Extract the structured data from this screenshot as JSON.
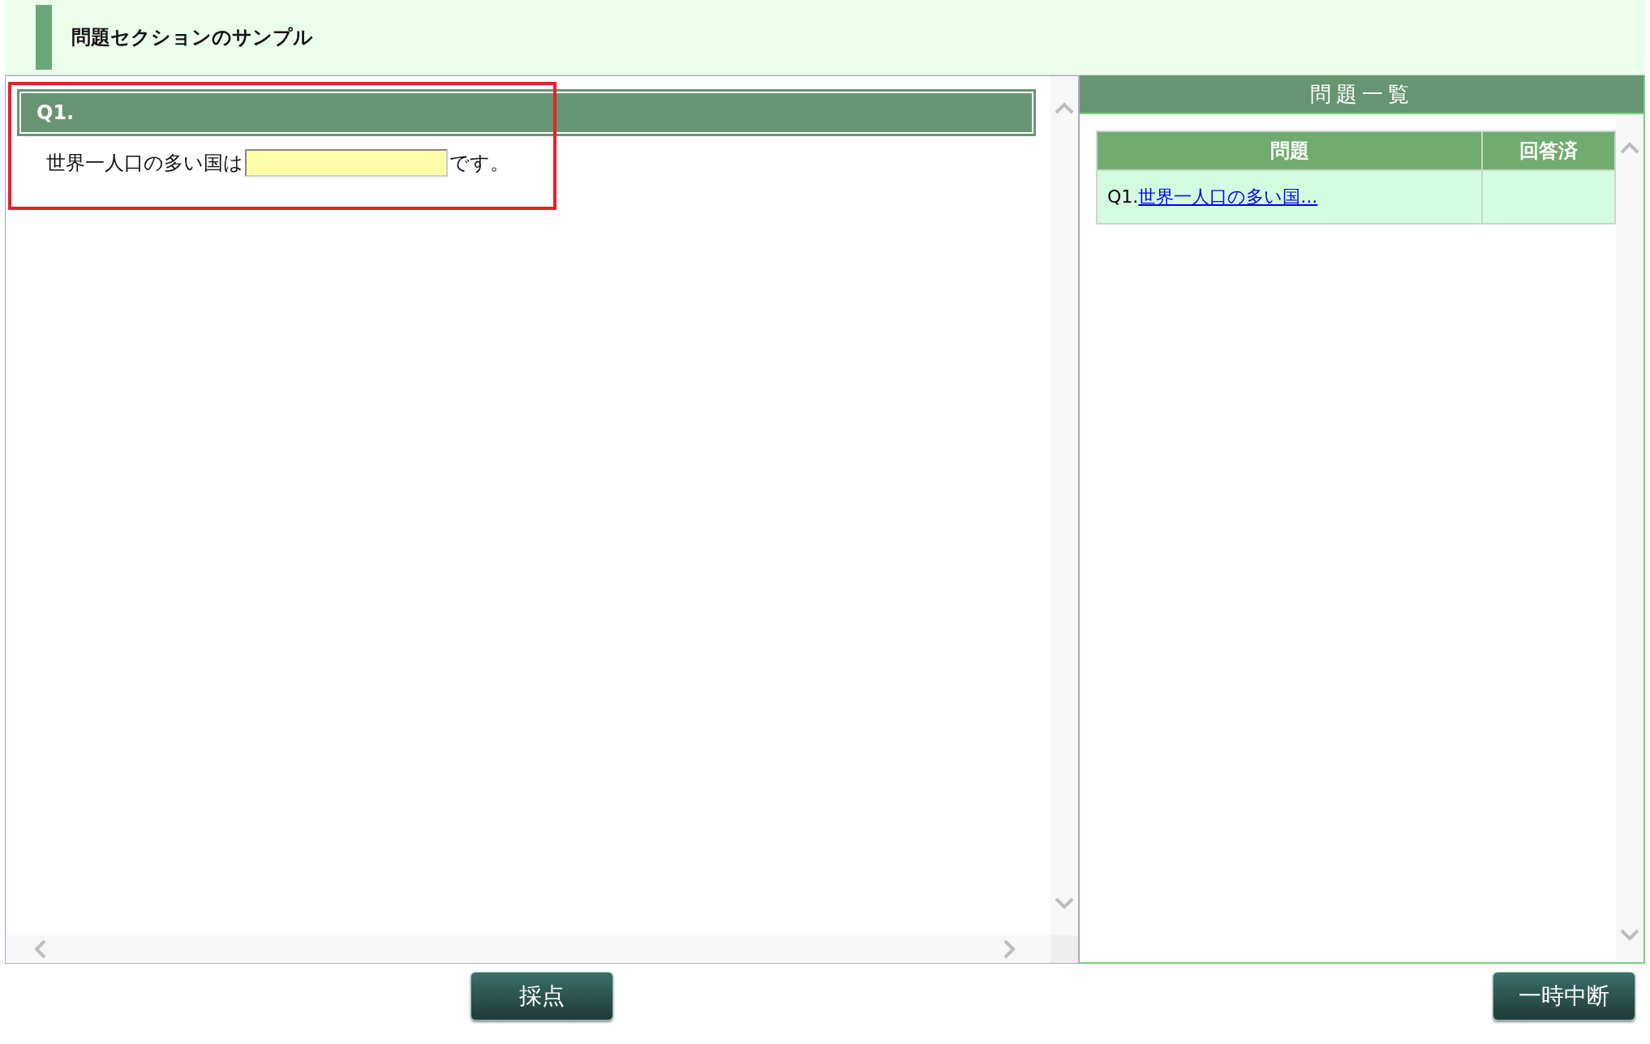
{
  "header": {
    "title": "問題セクションのサンプル"
  },
  "question": {
    "label": "Q1.",
    "before": "世界一人口の多い国は",
    "after": "です。",
    "highlighted": true
  },
  "question_list": {
    "title": "問題一覧",
    "columns": [
      "問題",
      "回答済"
    ],
    "rows": [
      {
        "prefix": "Q1.",
        "link": "世界一人口の多い国..."
      }
    ]
  },
  "buttons": [
    {
      "label": "採点"
    },
    {
      "label": "一時中断"
    }
  ]
}
